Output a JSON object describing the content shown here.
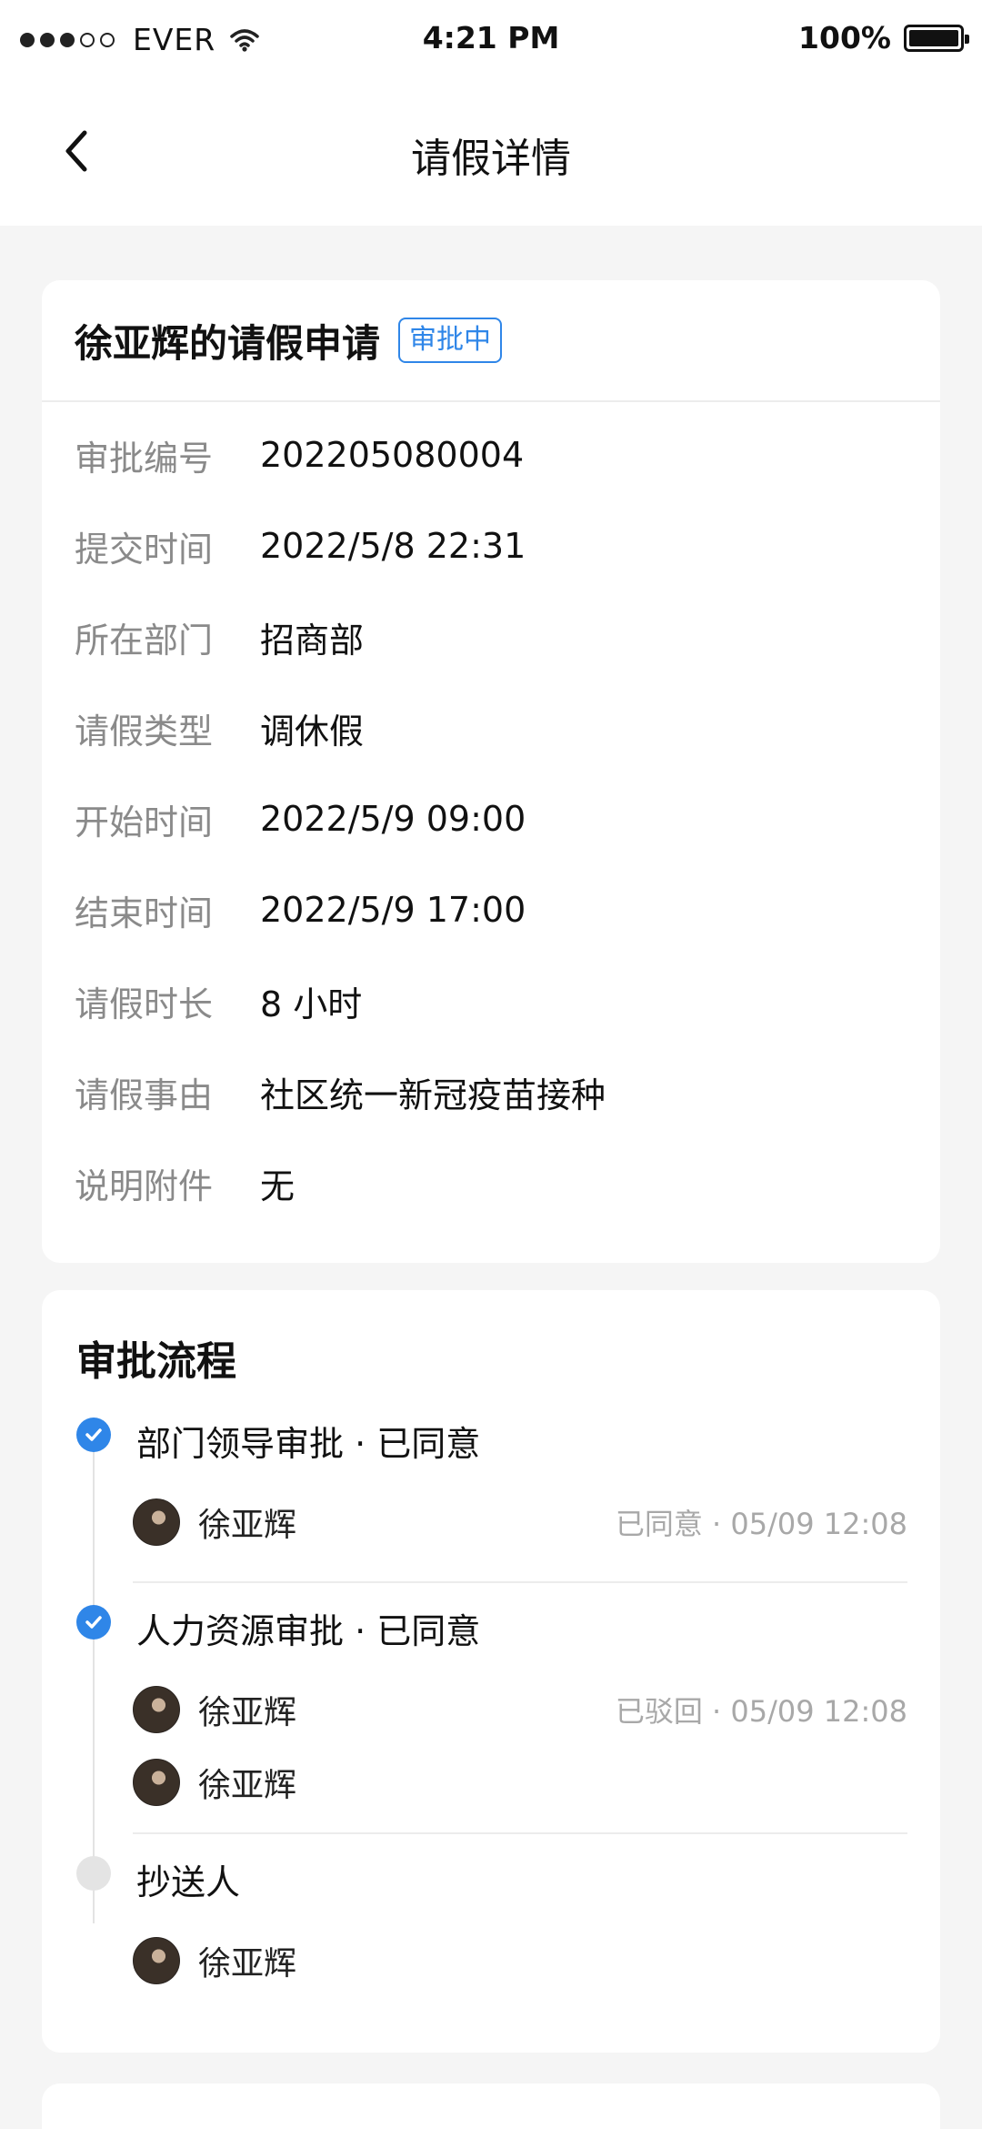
{
  "status_bar": {
    "carrier": "EVER",
    "time": "4:21 PM",
    "battery": "100%"
  },
  "nav": {
    "title": "请假详情"
  },
  "application": {
    "title": "徐亚辉的请假申请",
    "status_badge": "审批中",
    "fields": [
      {
        "label": "审批编号",
        "value": "202205080004"
      },
      {
        "label": "提交时间",
        "value": "2022/5/8 22:31"
      },
      {
        "label": "所在部门",
        "value": "招商部"
      },
      {
        "label": "请假类型",
        "value": "调休假"
      },
      {
        "label": "开始时间",
        "value": "2022/5/9 09:00"
      },
      {
        "label": "结束时间",
        "value": "2022/5/9 17:00"
      },
      {
        "label": "请假时长",
        "value": "8 小时"
      },
      {
        "label": "请假事由",
        "value": "社区统一新冠疫苗接种"
      },
      {
        "label": "说明附件",
        "value": "无"
      }
    ]
  },
  "process": {
    "title": "审批流程",
    "steps": [
      {
        "title": "部门领导审批 · 已同意",
        "state": "done",
        "approvers": [
          {
            "name": "徐亚辉",
            "status": "已同意 · 05/09 12:08"
          }
        ]
      },
      {
        "title": "人力资源审批 · 已同意",
        "state": "done",
        "approvers": [
          {
            "name": "徐亚辉",
            "status": "已驳回 · 05/09 12:08"
          },
          {
            "name": "徐亚辉",
            "status": ""
          }
        ]
      },
      {
        "title": "抄送人",
        "state": "pending",
        "approvers": [
          {
            "name": "徐亚辉",
            "status": ""
          }
        ]
      }
    ]
  },
  "colors": {
    "accent": "#2f86e8",
    "background": "#f5f5f5",
    "label_gray": "#8a8a8a"
  }
}
